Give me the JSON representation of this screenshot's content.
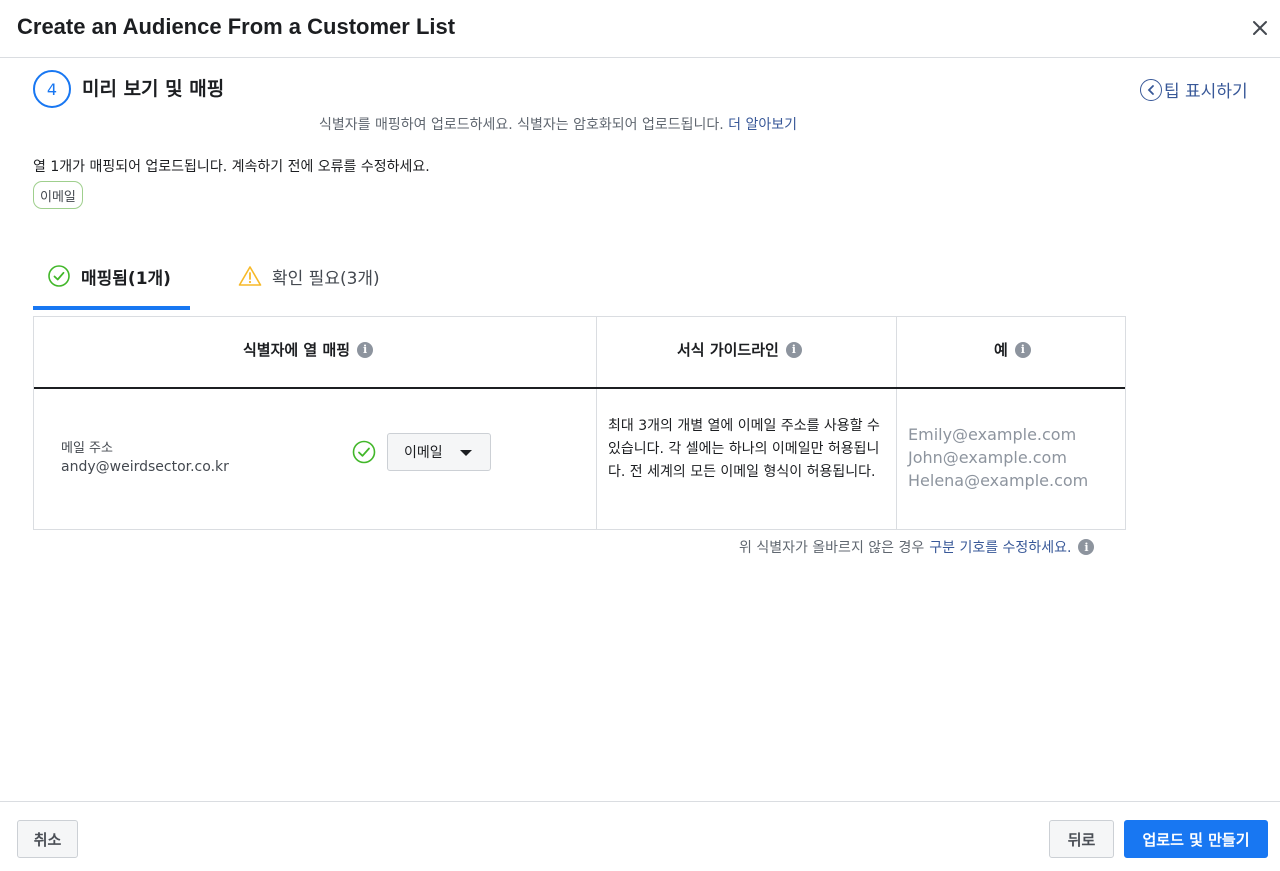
{
  "header": {
    "title": "Create an Audience From a Customer List",
    "close_icon": "close-icon"
  },
  "step": {
    "number": "4",
    "title": "미리 보기 및 매핑",
    "tips_label": "팁 표시하기"
  },
  "description": {
    "text": "식별자를 매핑하여 업로드하세요. 식별자는 암호화되어 업로드됩니다.",
    "link": "더 알아보기"
  },
  "summary": {
    "text": "열 1개가 매핑되어 업로드됩니다. 계속하기 전에 오류를 수정하세요.",
    "chip": "이메일"
  },
  "tabs": [
    {
      "label": "매핑됨(1개)",
      "icon": "check-circle-icon",
      "active": true
    },
    {
      "label": "확인 필요(3개)",
      "icon": "warning-icon",
      "active": false
    }
  ],
  "table": {
    "headers": [
      "식별자에 열 매핑",
      "서식 가이드라인",
      "예"
    ],
    "row": {
      "label": "메일 주소",
      "value": "andy@weirdsector.co.kr",
      "dropdown": "이메일",
      "guideline": "최대 3개의 개별 열에 이메일 주소를 사용할 수 있습니다. 각 셀에는 하나의 이메일만 허용됩니다. 전 세계의 모든 이메일 형식이 허용됩니다.",
      "examples": [
        "Emily@example.com",
        "John@example.com",
        "Helena@example.com"
      ]
    }
  },
  "footnote": {
    "text": "위 식별자가 올바르지 않은 경우",
    "link": "구분 기호를 수정하세요."
  },
  "footer": {
    "cancel": "취소",
    "back": "뒤로",
    "primary": "업로드 및 만들기"
  },
  "colors": {
    "accent": "#1877f2",
    "link": "#385898",
    "success": "#42b72a",
    "warning": "#f7b928"
  }
}
